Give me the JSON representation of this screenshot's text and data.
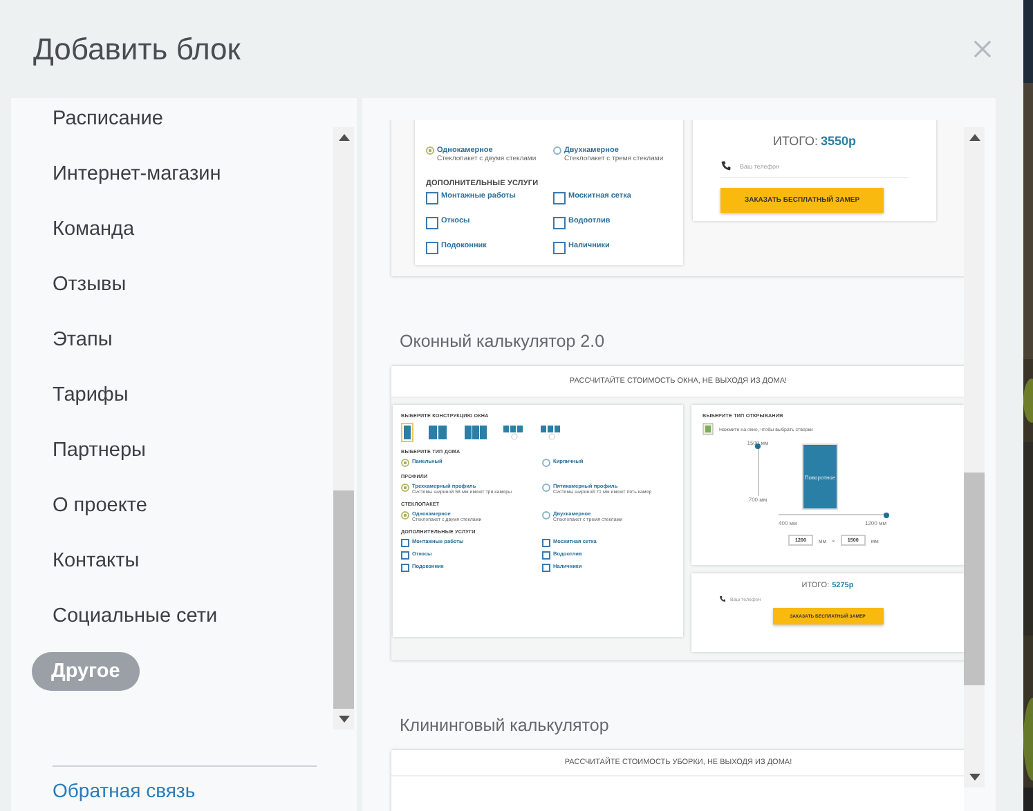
{
  "dialog": {
    "title": "Добавить блок"
  },
  "categories": [
    {
      "label": "Расписание",
      "selected": false
    },
    {
      "label": "Интернет-магазин",
      "selected": false
    },
    {
      "label": "Команда",
      "selected": false
    },
    {
      "label": "Отзывы",
      "selected": false
    },
    {
      "label": "Этапы",
      "selected": false
    },
    {
      "label": "Тарифы",
      "selected": false
    },
    {
      "label": "Партнеры",
      "selected": false
    },
    {
      "label": "О проекте",
      "selected": false
    },
    {
      "label": "Контакты",
      "selected": false
    },
    {
      "label": "Социальные сети",
      "selected": false
    },
    {
      "label": "Другое",
      "selected": true
    }
  ],
  "feedback_link": "Обратная связь",
  "blocks": [
    {
      "kind": "tail",
      "sections": [
        {
          "kind": "radio",
          "options": [
            {
              "label": "Однокамерное",
              "note": "Стеклопакет с двумя стеклами",
              "selected": true
            },
            {
              "label": "Двухкамерное",
              "note": "Стеклопакет с тремя стеклами",
              "selected": false
            }
          ]
        },
        {
          "kind": "checkbox",
          "heading": "ДОПОЛНИТЕЛЬНЫЕ УСЛУГИ",
          "options": [
            {
              "label": "Монтажные работы",
              "checked": false
            },
            {
              "label": "Москитная сетка",
              "checked": false
            },
            {
              "label": "Откосы",
              "checked": false
            },
            {
              "label": "Водоотлив",
              "checked": false
            },
            {
              "label": "Подоконник",
              "checked": false
            },
            {
              "label": "Наличники",
              "checked": false
            }
          ]
        }
      ],
      "order": {
        "total_label": "ИТОГО:",
        "total": "3550р",
        "phone_placeholder": "Ваш телефон",
        "button": "ЗАКАЗАТЬ БЕСПЛАТНЫЙ ЗАМЕР"
      }
    },
    {
      "kind": "full",
      "title": "Оконный калькулятор 2.0",
      "banner": "РАССЧИТАЙТЕ СТОИМОСТЬ ОКНА, НЕ ВЫХОДЯ ИЗ ДОМА!",
      "sections": [
        {
          "kind": "windows",
          "heading": "ВЫБЕРИТЕ КОНСТРУКЦИЮ ОКНА",
          "options": [
            {
              "kind": "one",
              "selected": true
            },
            {
              "kind": "two",
              "selected": false
            },
            {
              "kind": "three",
              "selected": false
            },
            {
              "kind": "three_small",
              "selected": false
            },
            {
              "kind": "three_small",
              "selected": false
            }
          ]
        },
        {
          "kind": "radio",
          "heading": "ВЫБЕРИТЕ ТИП ДОМА",
          "options": [
            {
              "label": "Панельный",
              "selected": true
            },
            {
              "label": "Кирпичный",
              "selected": false
            }
          ]
        },
        {
          "kind": "radio",
          "heading": "ПРОФИЛИ",
          "options": [
            {
              "label": "Трехкамерный профиль",
              "note": "Системы шириной 58 мм имеют три камеры",
              "selected": true
            },
            {
              "label": "Пятикамерный профиль",
              "note": "Системы шириной 71 мм имеют пять камер",
              "selected": false
            }
          ]
        },
        {
          "kind": "radio",
          "heading": "СТЕКЛОПАКЕТ",
          "options": [
            {
              "label": "Однокамерное",
              "note": "Стеклопакет с двумя стеклами",
              "selected": true
            },
            {
              "label": "Двухкамерное",
              "note": "Стеклопакет с тремя стеклами",
              "selected": false
            }
          ]
        },
        {
          "kind": "checkbox",
          "heading": "ДОПОЛНИТЕЛЬНЫЕ УСЛУГИ",
          "options": [
            {
              "label": "Монтажные работы",
              "checked": false
            },
            {
              "label": "Москитная сетка",
              "checked": false
            },
            {
              "label": "Откосы",
              "checked": false
            },
            {
              "label": "Водоотлив",
              "checked": false
            },
            {
              "label": "Подоконник",
              "checked": false
            },
            {
              "label": "Наличники",
              "checked": false
            }
          ]
        }
      ],
      "opening": {
        "heading": "ВЫБЕРИТЕ ТИП ОТКРЫВАНИЯ",
        "hint": "Нажмите на окно, чтобы выбрать створки",
        "height_max": "1500 мм",
        "height_min": "700 мм",
        "height_slider": {
          "level": 1
        },
        "sash_label": "Поворотное",
        "width_min": "400 мм",
        "width_max": "1200 мм",
        "width_slider": {
          "level": 1
        },
        "width_value": "1200",
        "width_unit": "мм",
        "times": "×",
        "height_value": "1500",
        "height_unit": "мм"
      },
      "order": {
        "total_label": "ИТОГО:",
        "total": "5275р",
        "phone_placeholder": "Ваш телефон",
        "button": "ЗАКАЗАТЬ БЕСПЛАТНЫЙ ЗАМЕР"
      }
    },
    {
      "kind": "head",
      "title": "Клининговый калькулятор",
      "banner": "РАССЧИТАЙТЕ СТОИМОСТЬ УБОРКИ, НЕ ВЫХОДЯ ИЗ ДОМА!"
    }
  ]
}
